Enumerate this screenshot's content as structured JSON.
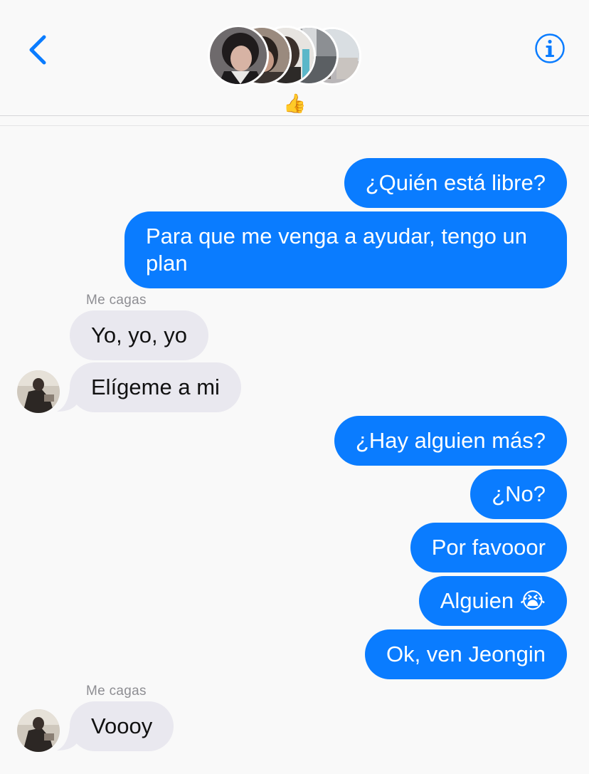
{
  "header": {
    "back_icon": "chevron-left-icon",
    "info_icon": "info-circle-icon",
    "group_reaction": "👍",
    "accent_color": "#0a7cff"
  },
  "conversation": {
    "messages": [
      {
        "direction": "outgoing",
        "text": "¿Quién está libre?"
      },
      {
        "direction": "outgoing",
        "text": "Para que me venga a ayudar, tengo un plan"
      },
      {
        "direction": "incoming",
        "sender": "Me cagas",
        "text": "Yo, yo, yo"
      },
      {
        "direction": "incoming",
        "text": "Elígeme a mi"
      },
      {
        "direction": "outgoing",
        "text": "¿Hay alguien más?"
      },
      {
        "direction": "outgoing",
        "text": "¿No?"
      },
      {
        "direction": "outgoing",
        "text": "Por favooor"
      },
      {
        "direction": "outgoing",
        "text": "Alguien 😭"
      },
      {
        "direction": "outgoing",
        "text": "Ok, ven Jeongin"
      },
      {
        "direction": "incoming",
        "sender": "Me cagas",
        "text": "Voooy"
      }
    ]
  },
  "colors": {
    "outgoing_bubble": "#0a7cff",
    "incoming_bubble": "#e9e8ef",
    "background": "#f9f9f9"
  }
}
